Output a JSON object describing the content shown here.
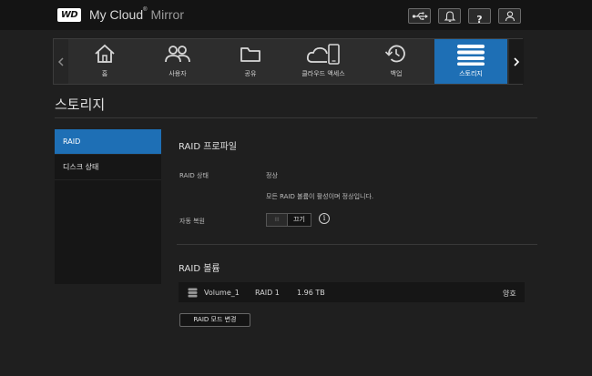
{
  "header": {
    "logo_text": "WD",
    "app_name": "My Cloud",
    "app_suffix": "Mirror",
    "buttons": [
      {
        "icon": "usb-icon"
      },
      {
        "icon": "bell-icon"
      },
      {
        "icon": "help-icon",
        "label": "?"
      },
      {
        "icon": "user-icon"
      }
    ]
  },
  "nav": {
    "items": [
      {
        "icon": "home-icon",
        "label": "홈"
      },
      {
        "icon": "users-icon",
        "label": "사용자"
      },
      {
        "icon": "folder-icon",
        "label": "공유"
      },
      {
        "icon": "cloud-device-icon",
        "label": "클라우드 액세스"
      },
      {
        "icon": "history-icon",
        "label": "백업"
      },
      {
        "icon": "storage-icon",
        "label": "스토리지",
        "active": true
      }
    ]
  },
  "page": {
    "title": "스토리지"
  },
  "sidebar": {
    "items": [
      {
        "label": "RAID",
        "active": true
      },
      {
        "label": "디스크 상태"
      }
    ]
  },
  "raid_profile": {
    "title": "RAID 프로파일",
    "status_label": "RAID 상태",
    "status_value": "정상",
    "status_message": "모든 RAID 볼륨이 활성이며 정상입니다.",
    "auto_rebuild_label": "자동 복원",
    "toggle_handle": "III",
    "toggle_state": "끄기",
    "info_glyph": "i"
  },
  "raid_volume": {
    "title": "RAID 볼륨",
    "volumes": [
      {
        "name": "Volume_1",
        "raid": "RAID 1",
        "size": "1.96 TB",
        "status": "양호"
      }
    ],
    "change_button": "RAID 모드 변경"
  },
  "colors": {
    "accent": "#1e6fb5",
    "background": "#1f1f1f",
    "topbar": "#141414"
  }
}
